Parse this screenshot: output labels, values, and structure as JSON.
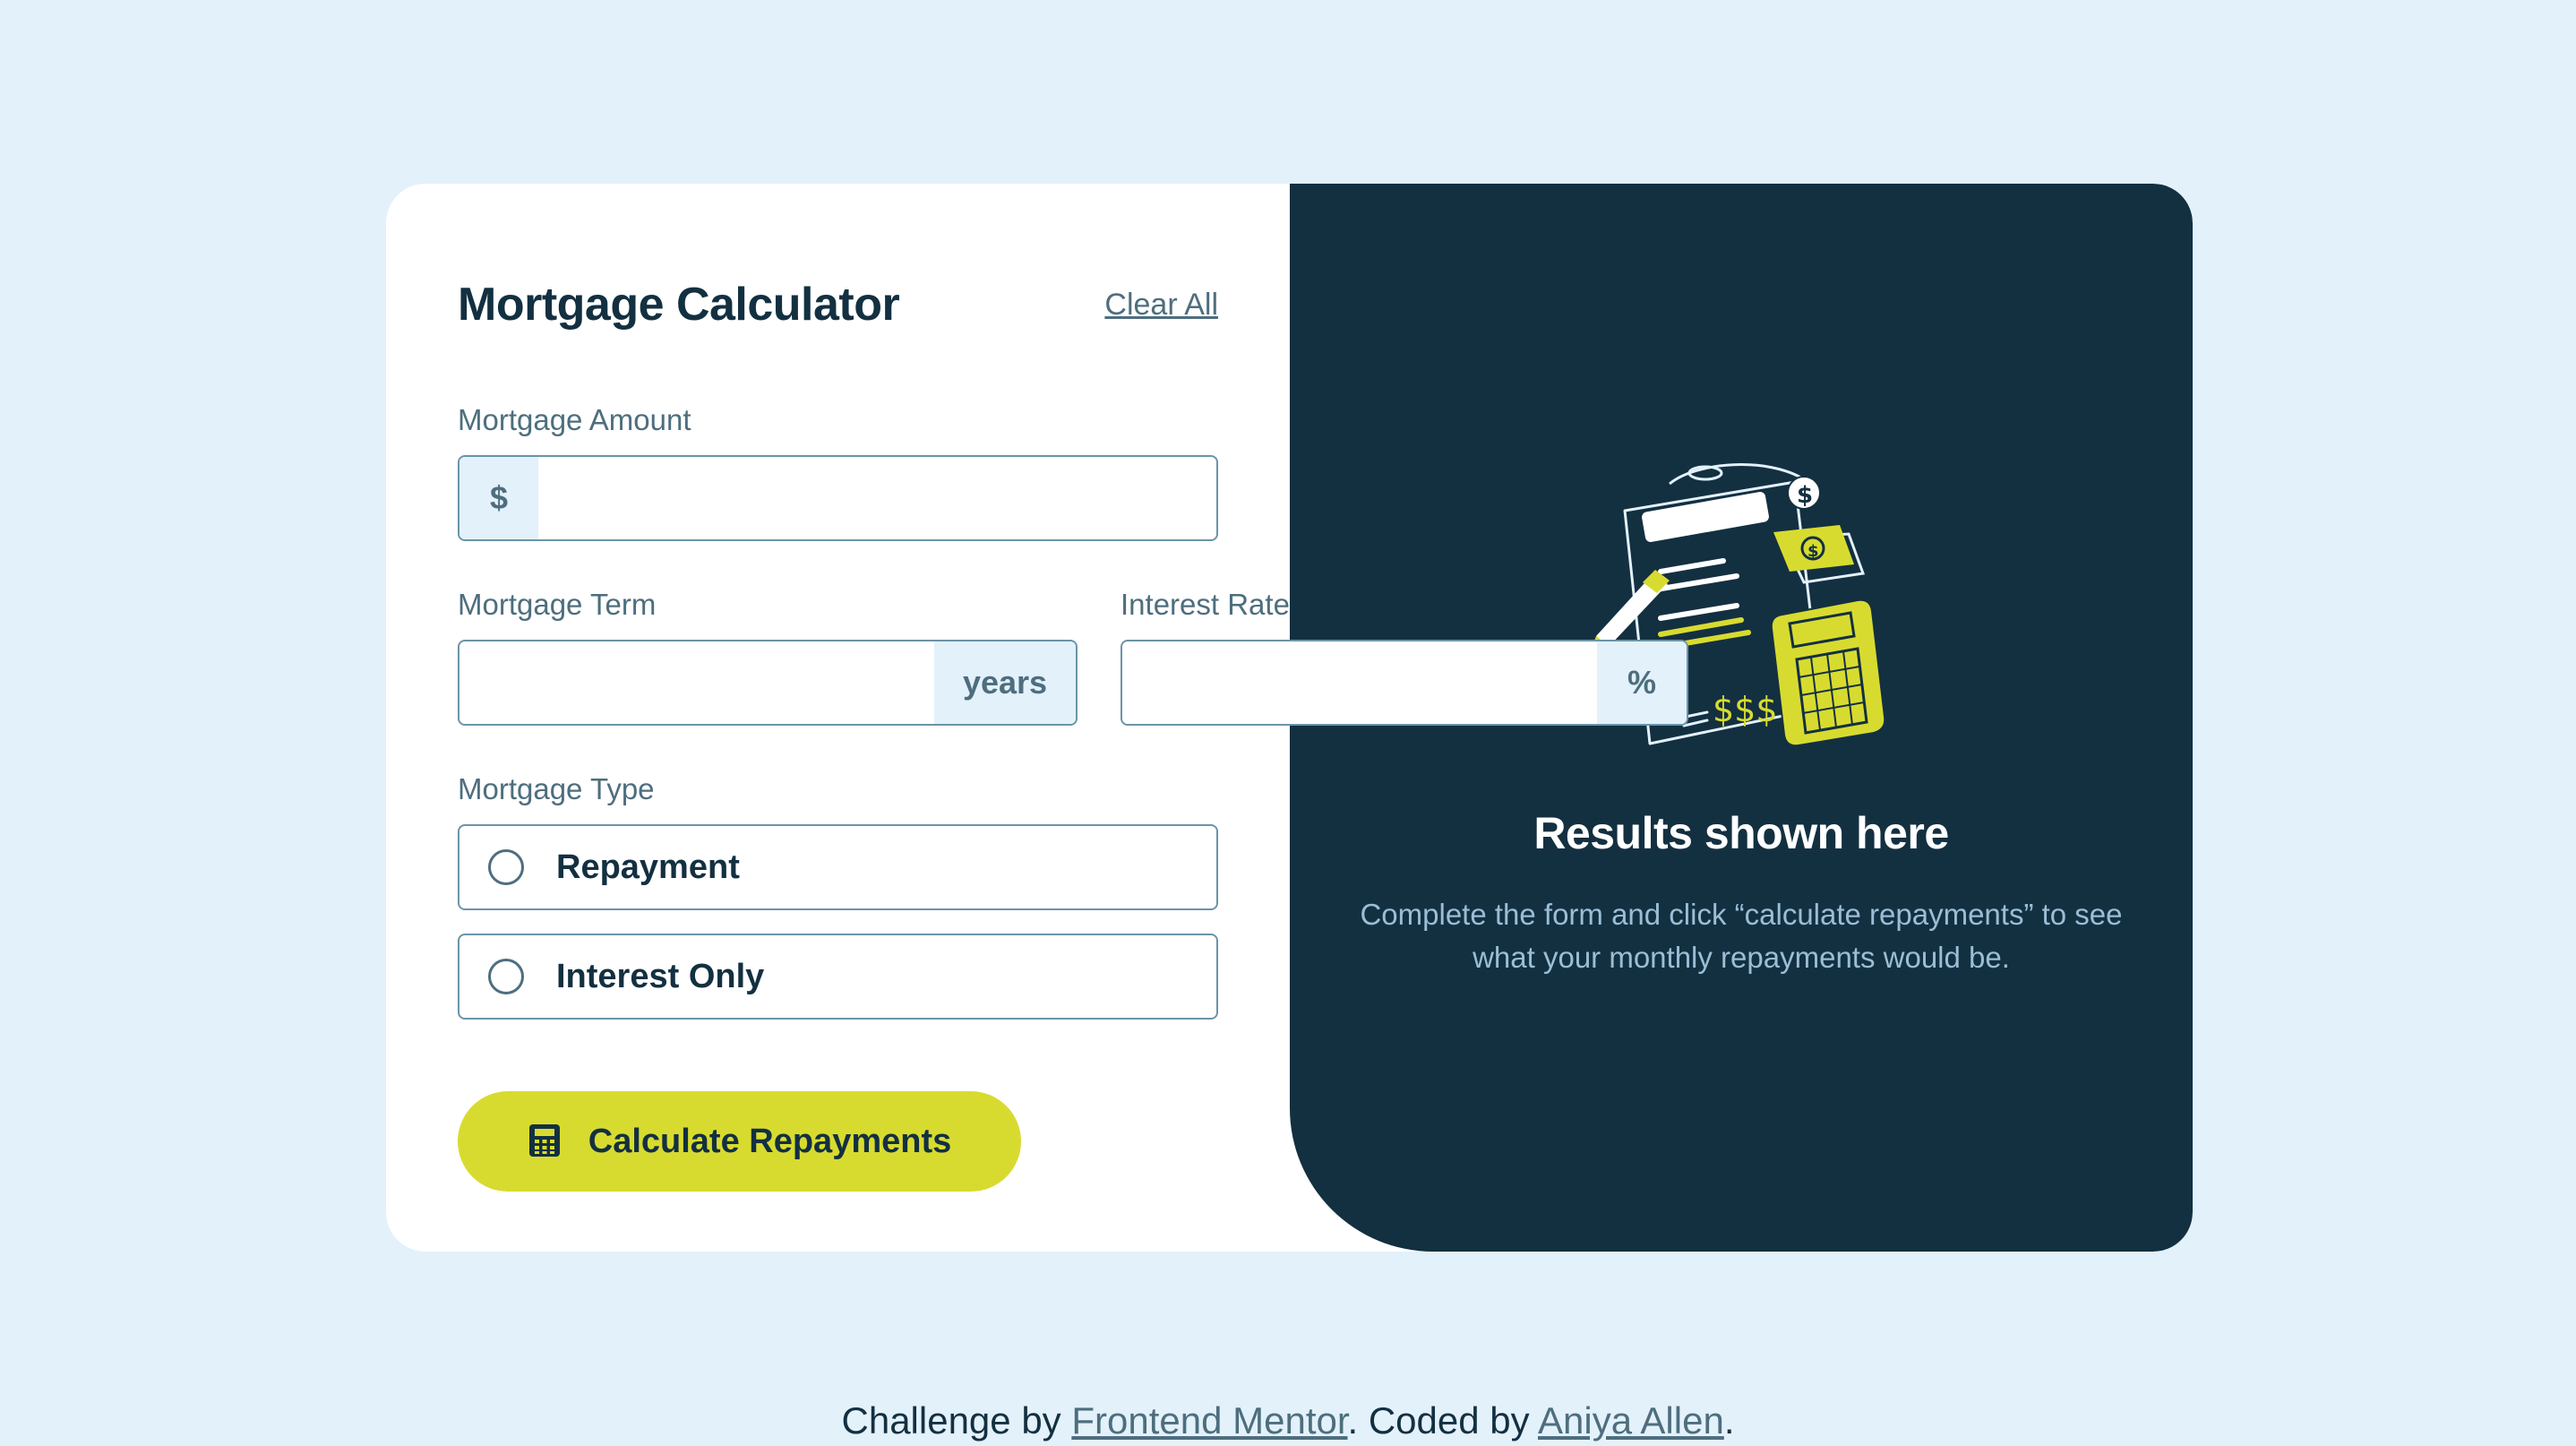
{
  "form": {
    "title": "Mortgage Calculator",
    "clear_all": "Clear All",
    "amount": {
      "label": "Mortgage Amount",
      "prefix": "$",
      "value": ""
    },
    "term": {
      "label": "Mortgage Term",
      "suffix": "years",
      "value": ""
    },
    "rate": {
      "label": "Interest Rate",
      "suffix": "%",
      "value": ""
    },
    "type": {
      "label": "Mortgage Type",
      "options": [
        {
          "label": "Repayment",
          "selected": false
        },
        {
          "label": "Interest Only",
          "selected": false
        }
      ]
    },
    "submit_label": "Calculate Repayments"
  },
  "results": {
    "title": "Results shown here",
    "text": "Complete the form and click “calculate repayments” to see what your monthly repayments would be."
  },
  "footer": {
    "prefix": "Challenge by ",
    "link1": "Frontend Mentor",
    "middle": ". Coded by ",
    "link2": "Aniya Allen",
    "suffix": "."
  },
  "colors": {
    "background": "#e3f1fb",
    "accent": "#d8db2f",
    "dark": "#133041",
    "muted": "#4e6e7e"
  },
  "icons": [
    "calculator-icon",
    "illustration-empty"
  ]
}
